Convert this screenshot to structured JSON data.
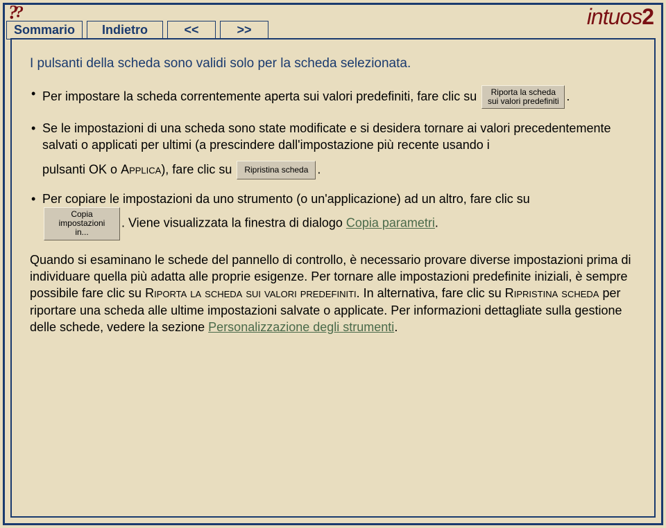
{
  "brand": {
    "name": "intuos",
    "suffix": "2"
  },
  "nav": {
    "summary": "Sommario",
    "back": "Indietro",
    "prev": "<<",
    "next": ">>"
  },
  "help_glyph": "?",
  "intro": "I pulsanti della scheda sono validi solo per la scheda selezionata.",
  "bullets": {
    "b1_pre": "Per impostare la scheda correntemente aperta sui valori predefiniti, fare clic su ",
    "b1_btn_l1": "Riporta la scheda",
    "b1_btn_l2": "sui valori predefiniti",
    "b1_post": ".",
    "b2_p1": "Se le impostazioni di una scheda sono state modificate e si desidera tornare ai valori precedentemente salvati o applicati per ultimi (a prescindere dall'impostazione più recente usando i",
    "b2_p2_pre": "pulsanti OK o ",
    "b2_applica": "Applica",
    "b2_p2_mid": "), fare clic su ",
    "b2_btn": "Ripristina scheda",
    "b2_post": ".",
    "b3_line1": "Per copiare le impostazioni da uno strumento (o un'applicazione) ad un altro, fare clic su",
    "b3_btn_l1": "Copia impostazioni",
    "b3_btn_l2": "in...",
    "b3_mid": ". Viene visualizzata la finestra di dialogo ",
    "b3_link": "Copia parametri",
    "b3_post": "."
  },
  "paragraph": {
    "p1": "Quando si esaminano le schede del pannello di controllo, è necessario provare diverse impostazioni prima di individuare quella più adatta alle proprie esigenze. Per tornare alle impostazioni predefinite iniziali, è sempre possibile fare clic su ",
    "sc1": "Riporta la scheda sui valori predefiniti",
    "p2": ". In alternativa, fare clic su ",
    "sc2": "Ripristina scheda",
    "p3": " per riportare una scheda alle ultime impostazioni salvate o applicate. Per informazioni dettagliate sulla gestione delle schede, vedere la sezione ",
    "link": "Personalizzazione degli strumenti",
    "p4": "."
  }
}
